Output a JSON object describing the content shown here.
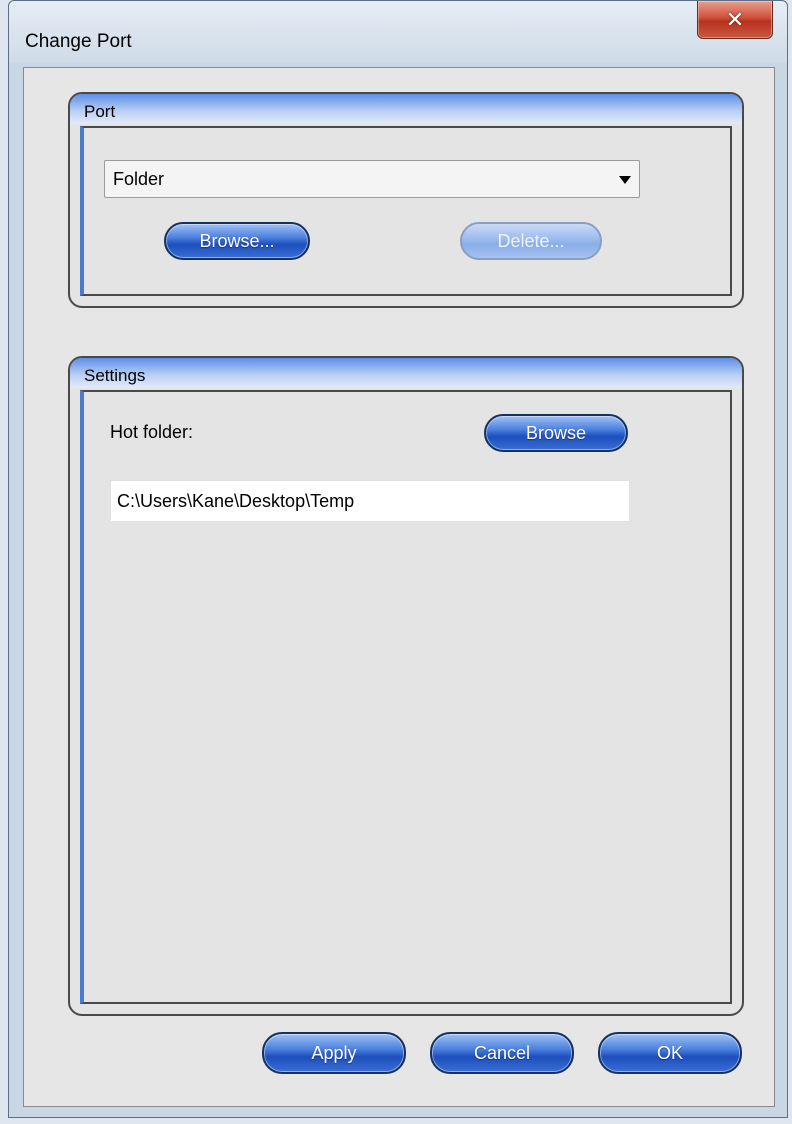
{
  "window": {
    "title": "Change Port",
    "close_icon": "close-icon"
  },
  "port_group": {
    "header": "Port",
    "selected_port": "Folder",
    "browse_label": "Browse...",
    "delete_label": "Delete..."
  },
  "settings_group": {
    "header": "Settings",
    "hot_folder_label": "Hot folder:",
    "browse_label": "Browse",
    "hot_folder_path": "C:\\Users\\Kane\\Desktop\\Temp"
  },
  "footer": {
    "apply_label": "Apply",
    "cancel_label": "Cancel",
    "ok_label": "OK"
  },
  "colors": {
    "accent_blue": "#1d4fbd",
    "group_header": "#5d8fe8",
    "close_red": "#c9583e"
  }
}
